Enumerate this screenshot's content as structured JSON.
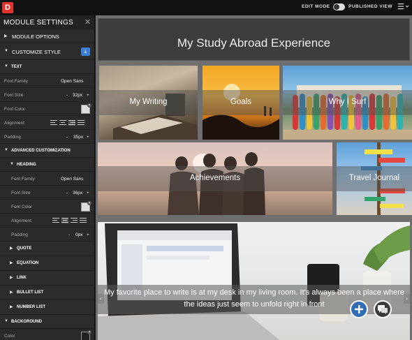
{
  "topbar": {
    "logo_letter": "D",
    "edit_mode": "EDIT MODE",
    "published_view": "PUBLISHED VIEW",
    "menu_icon": "hamburger-icon"
  },
  "sidebar": {
    "title": "MODULE SETTINGS",
    "close": "✕",
    "module_options": "MODULE OPTIONS",
    "customize_style": "CUSTOMIZE STYLE",
    "text_section": "TEXT",
    "text": {
      "font_family_label": "Font Family",
      "font_family_value": "Open Sans",
      "font_size_label": "Font Size",
      "font_size_value": "32px",
      "font_color_label": "Font Color",
      "alignment_label": "Alignment",
      "padding_label": "Padding",
      "padding_value": "35px"
    },
    "advanced": "ADVANCED CUSTOMIZATION",
    "heading_section": "HEADING",
    "heading": {
      "font_family_label": "Font Family",
      "font_family_value": "Open Sans",
      "font_size_label": "Font Size",
      "font_size_value": "36px",
      "font_color_label": "Font Color",
      "alignment_label": "Alignment",
      "padding_label": "Padding",
      "padding_value": "0px"
    },
    "sub_sections": [
      "QUOTE",
      "EQUATION",
      "LINK",
      "BULLET LIST",
      "NUMBER LIST"
    ],
    "background_section": "BACKGROUND",
    "bg_color_label": "Color",
    "minus": "-",
    "plus": "+"
  },
  "main": {
    "hero_title": "My Study Abroad Experience",
    "tiles": [
      "My Writing",
      "Goals",
      "Why I Surf",
      "Achievements",
      "Travel Journal"
    ],
    "quote": "My favorite place to write is at my desk in my living room. It's always been a place where the ideas just seem to unfold right in front",
    "prev": "‹",
    "next": "›"
  },
  "colors": {
    "accent_blue": "#3a7fd5",
    "logo_red": "#e5322d",
    "fab_blue": "#2f6db5",
    "fab_dark": "#3b3b3b"
  }
}
